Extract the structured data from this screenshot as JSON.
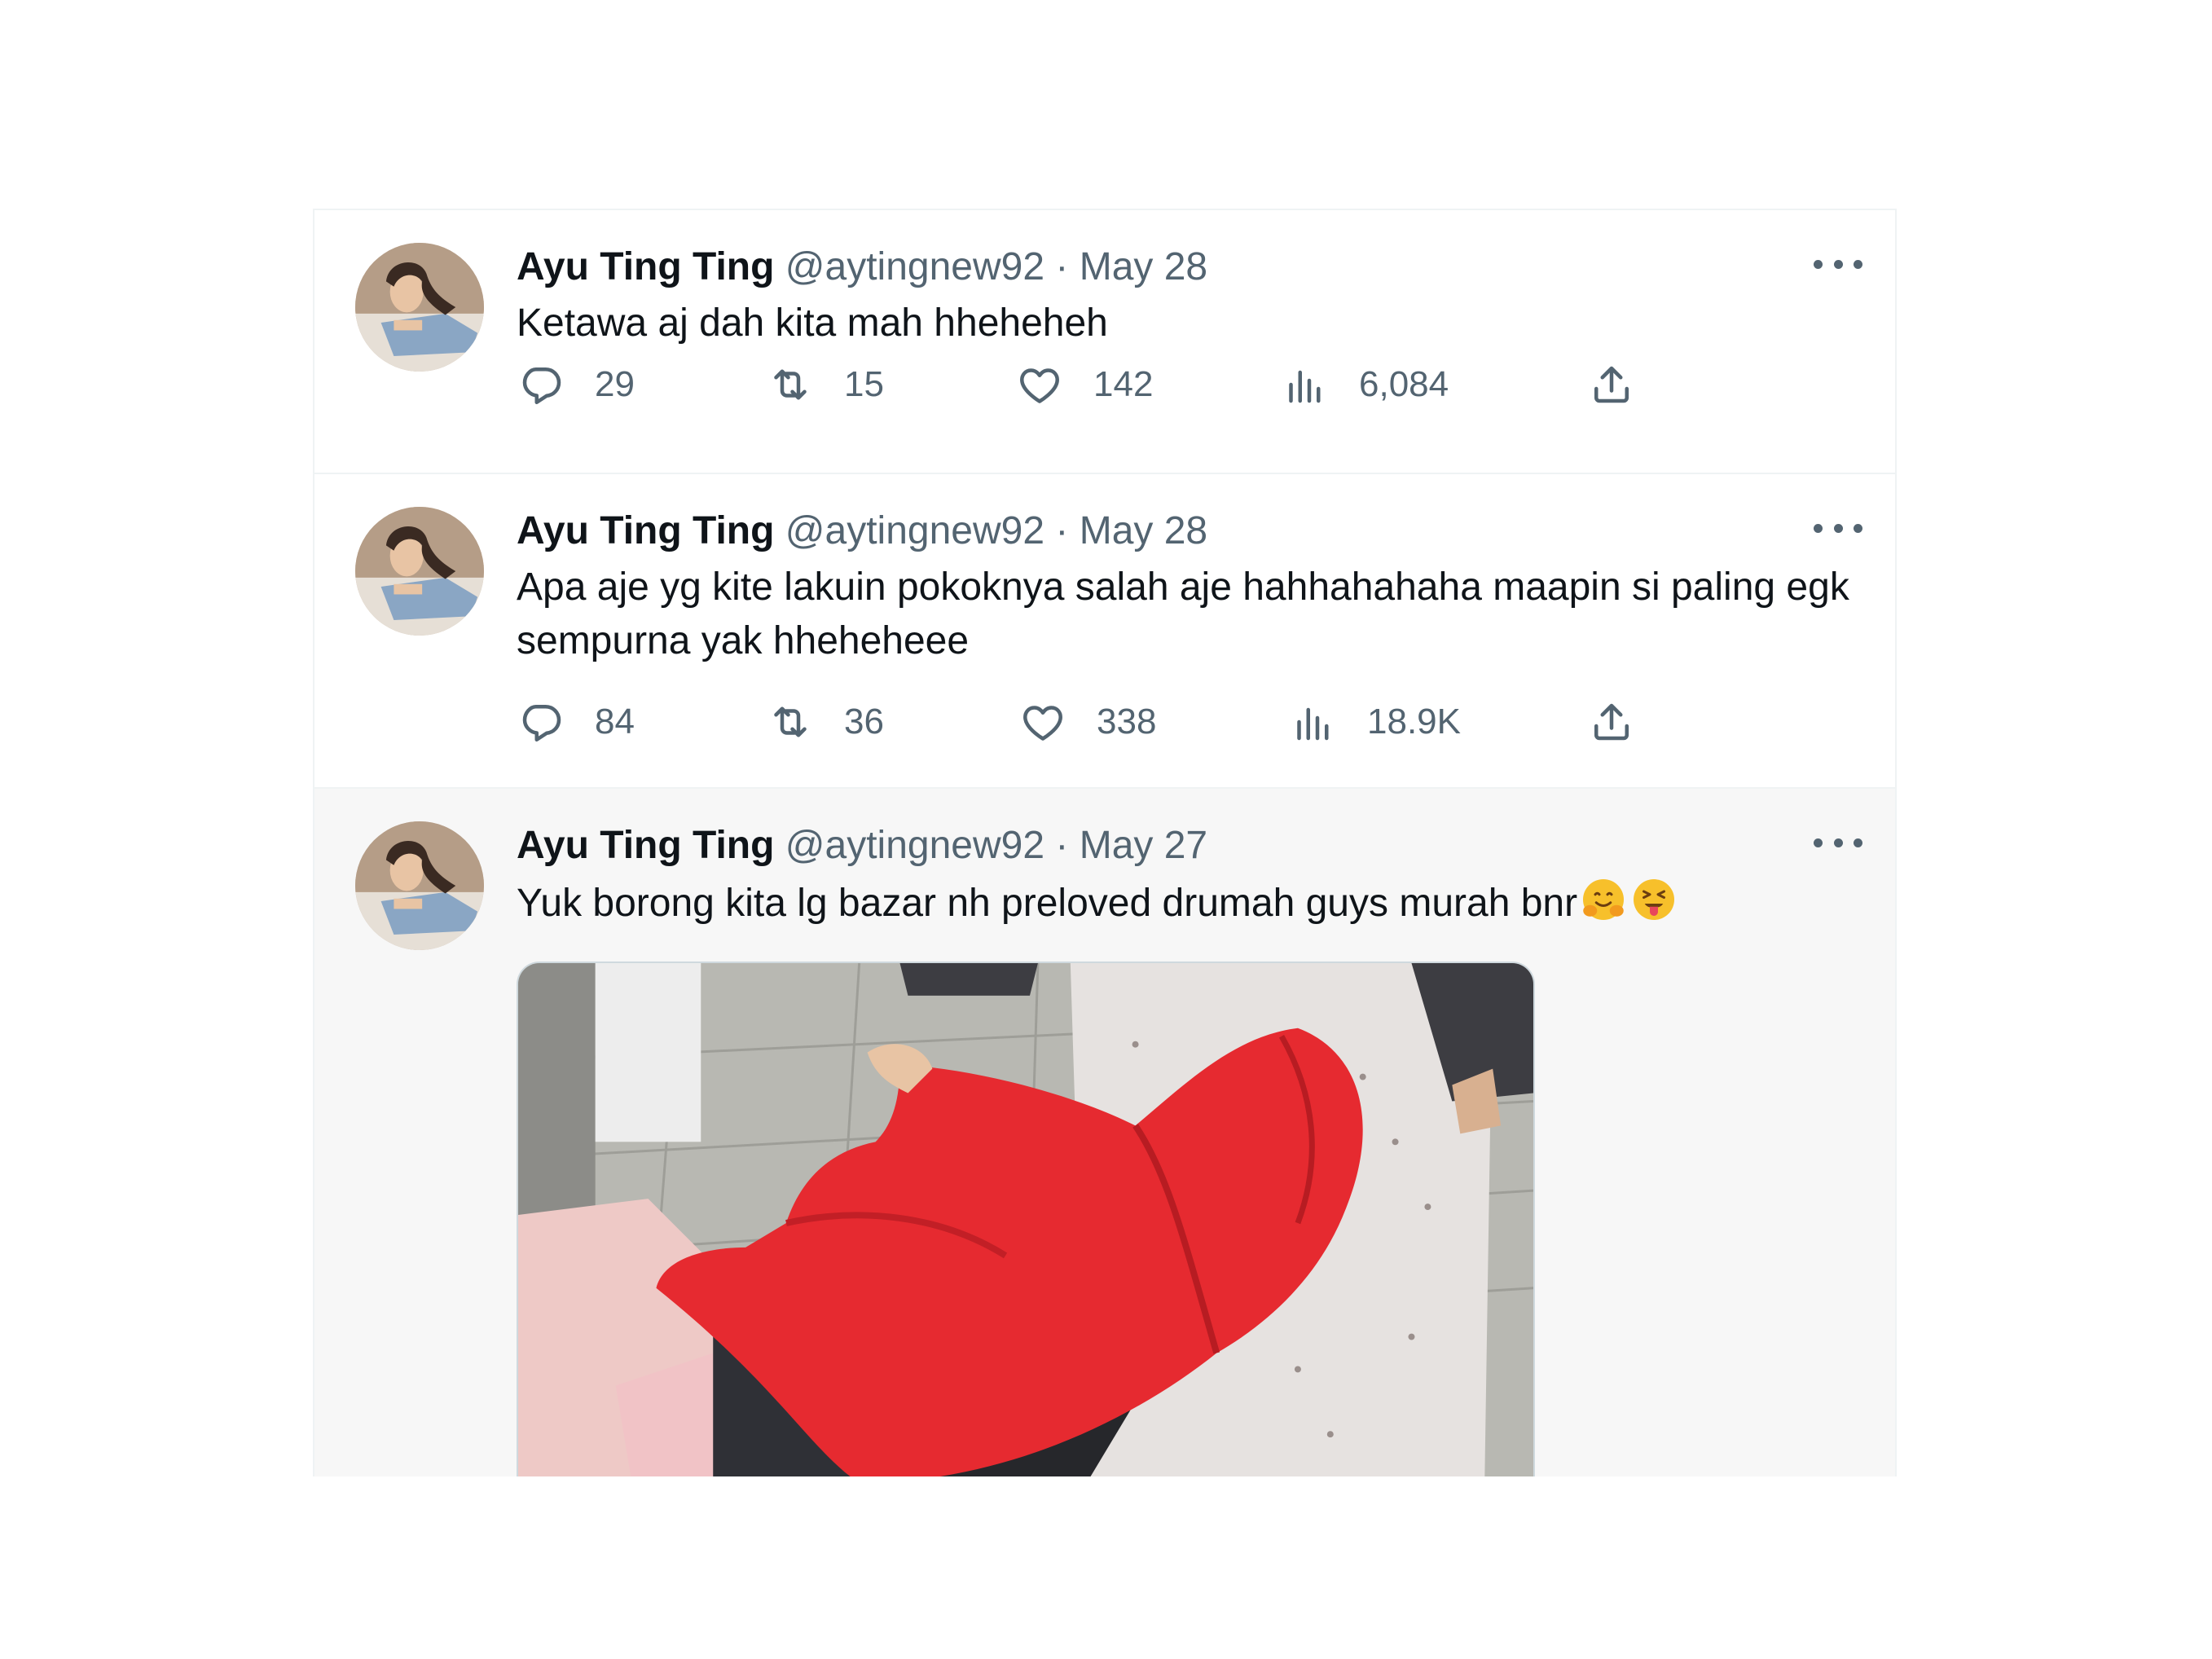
{
  "tweets": [
    {
      "name": "Ayu Ting Ting",
      "handle": "@aytingnew92",
      "sep": "·",
      "date": "May 28",
      "text": "Ketawa aj dah kita mah hheheheh",
      "replies": "29",
      "retweets": "15",
      "likes": "142",
      "views": "6,084"
    },
    {
      "name": "Ayu Ting Ting",
      "handle": "@aytingnew92",
      "sep": "·",
      "date": "May 28",
      "text": "Apa aje yg kite lakuin pokoknya salah aje hahhahahaha maapin si paling egk sempurna yak hheheheee",
      "replies": "84",
      "retweets": "36",
      "likes": "338",
      "views": "18.9K"
    },
    {
      "name": "Ayu Ting Ting",
      "handle": "@aytingnew92",
      "sep": "·",
      "date": "May 27",
      "text": "Yuk borong kita lg bazar nh preloved drumah guys murah bnr",
      "emojis": [
        "hugging-face-emoji",
        "squinting-tongue-emoji"
      ]
    }
  ],
  "icons": [
    "more-icon",
    "reply-icon",
    "retweet-icon",
    "like-icon",
    "views-icon",
    "share-icon"
  ],
  "colors": {
    "text": "#0f1419",
    "secondary": "#536471",
    "divider": "#eff3f4",
    "highlight_bg": "#f7f7f7"
  }
}
